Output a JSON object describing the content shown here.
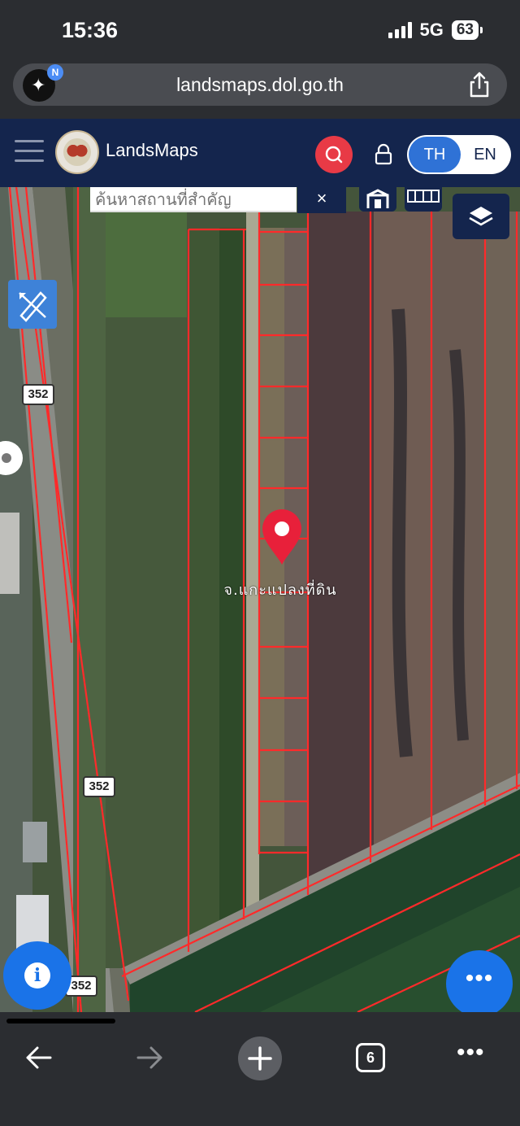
{
  "status": {
    "time": "15:36",
    "network": "5G",
    "battery": "63"
  },
  "browser": {
    "url": "landsmaps.dol.go.th",
    "ai_badge_letter": "N",
    "tab_count": "6"
  },
  "app": {
    "brand": "LandsMaps",
    "lang_th": "TH",
    "lang_en": "EN"
  },
  "map": {
    "search_placeholder": "ค้นหาสถานที่สำคัญ",
    "clear_label": "×",
    "road_numbers": [
      "352",
      "352",
      "352"
    ],
    "parcel_label": "จ.แกะแปลงที่ดิน",
    "info_label": "i",
    "more_label": "•••"
  },
  "colors": {
    "header": "#14254d",
    "accent_blue": "#1a73e8",
    "pin_red": "#e8203a",
    "parcel_lines": "#ff2222"
  }
}
